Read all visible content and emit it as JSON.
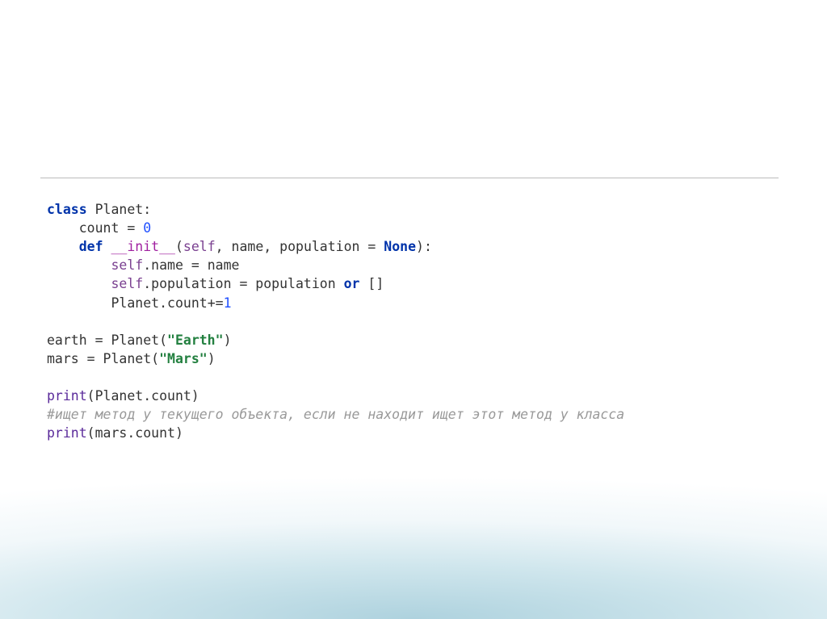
{
  "code": {
    "l1_class": "class",
    "l1_name": "Planet:",
    "l2_count": "count = ",
    "l2_zero": "0",
    "l3_def": "def",
    "l3_dunder": "__init__",
    "l3_paren_open": "(",
    "l3_self": "self",
    "l3_args_rest": ", name, population = ",
    "l3_none": "None",
    "l3_paren_close": "):",
    "l4_self": "self",
    "l4_rest": ".name = name",
    "l5_self": "self",
    "l5_mid": ".population = population ",
    "l5_or": "or",
    "l5_end": " []",
    "l6": "Planet.count+=",
    "l6_one": "1",
    "l8": "earth = Planet(",
    "l8_str": "\"Earth\"",
    "l8_end": ")",
    "l9": "mars = Planet(",
    "l9_str": "\"Mars\"",
    "l9_end": ")",
    "l11_print": "print",
    "l11_rest": "(Planet.count)",
    "l12_comment": "#ищет метод у текущего объекта, если не находит ищет этот метод у класса",
    "l13_print": "print",
    "l13_rest": "(mars.count)"
  }
}
